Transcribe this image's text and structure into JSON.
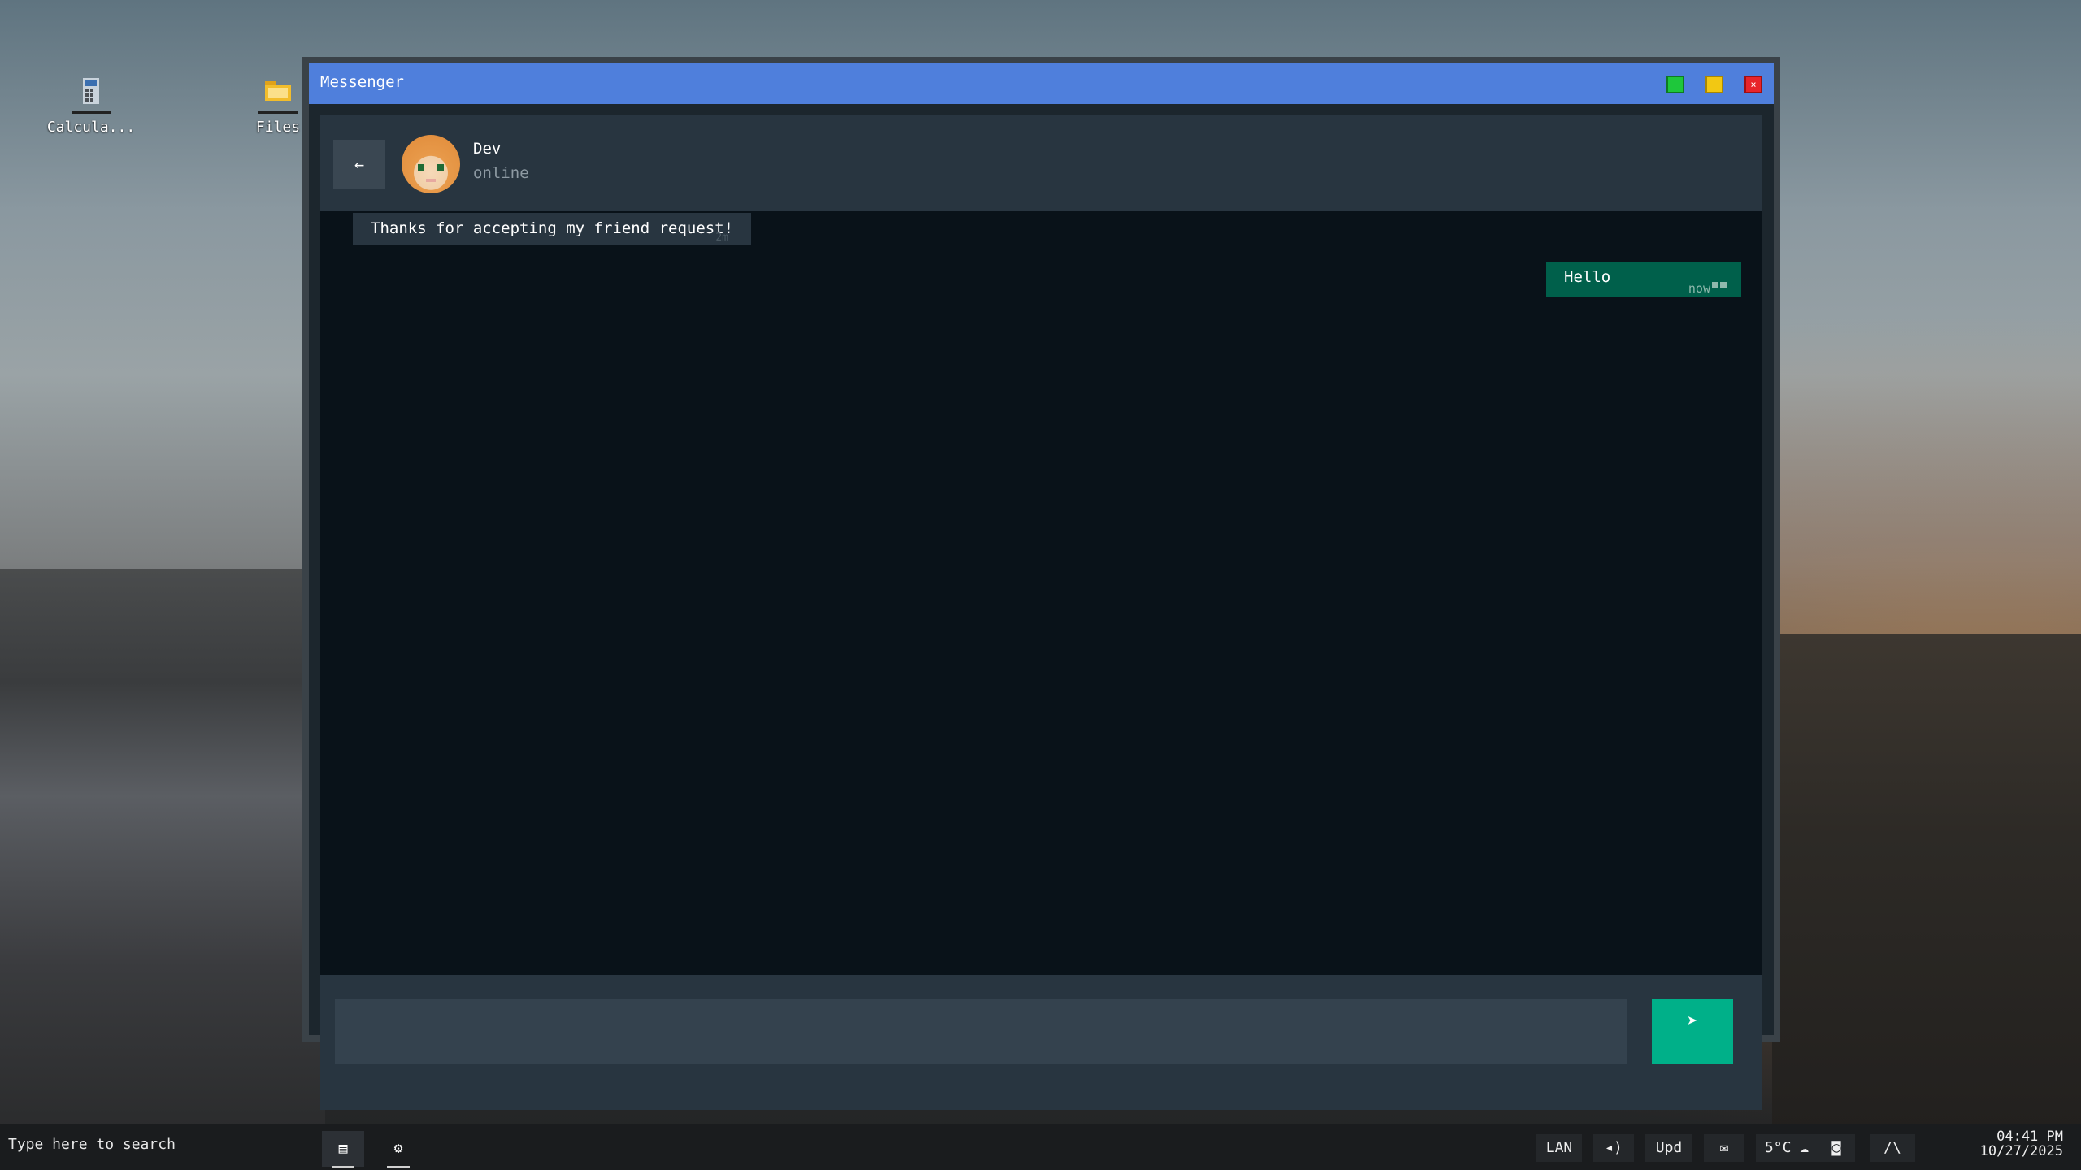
{
  "desktop": {
    "icons": [
      {
        "label": "Calcula..."
      },
      {
        "label": "Files"
      }
    ]
  },
  "window": {
    "title": "Messenger",
    "controls": {
      "close": "×"
    }
  },
  "chat": {
    "back_label": "←",
    "contact": {
      "name": "Dev",
      "status": "online"
    },
    "messages": [
      {
        "direction": "in",
        "text": "Thanks for accepting my friend request!",
        "time": "2m"
      },
      {
        "direction": "out",
        "text": "Hello",
        "time": "now"
      }
    ],
    "input": {
      "value": "",
      "placeholder": ""
    },
    "send_label": "➤"
  },
  "taskbar": {
    "search_placeholder": "Type here to search",
    "apps": [
      {
        "icon": "chat-icon",
        "glyph": "▤"
      },
      {
        "icon": "gear-icon",
        "glyph": "⚙"
      }
    ],
    "tray": {
      "network": "LAN",
      "volume": "◂)",
      "update": "Upd",
      "mail": "✉",
      "weather": "5°C ☁",
      "camera": "◙",
      "overflow": "/\\"
    },
    "clock": {
      "time": "04:41 PM",
      "date": "10/27/2025"
    }
  },
  "colors": {
    "titlebar": "#4f7fdc",
    "chat_bg": "#091219",
    "panel": "#283540",
    "outgoing_bubble": "#00604b",
    "send_button": "#00b089"
  }
}
